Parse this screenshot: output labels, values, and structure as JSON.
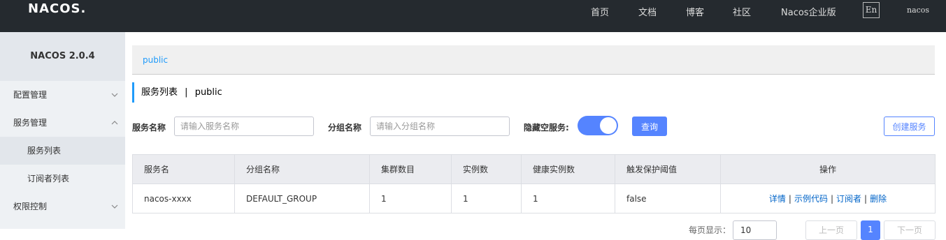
{
  "header": {
    "logo": "NACOS",
    "logo_dot": ".",
    "nav": [
      "首页",
      "文档",
      "博客",
      "社区",
      "Nacos企业版"
    ],
    "lang": "En",
    "user": "nacos"
  },
  "sidebar": {
    "version": "NACOS 2.0.4",
    "items": [
      {
        "label": "配置管理",
        "expanded": false
      },
      {
        "label": "服务管理",
        "expanded": true
      },
      {
        "label": "服务列表",
        "active": true
      },
      {
        "label": "订阅者列表"
      },
      {
        "label": "权限控制",
        "expanded": false
      }
    ]
  },
  "namespace": {
    "current": "public"
  },
  "page": {
    "title": "服务列表",
    "separator": "|",
    "namespace": "public"
  },
  "filters": {
    "service_label": "服务名称",
    "service_placeholder": "请输入服务名称",
    "group_label": "分组名称",
    "group_placeholder": "请输入分组名称",
    "hide_empty_label": "隐藏空服务:",
    "hide_empty_on": true,
    "query_button": "查询",
    "create_button": "创建服务"
  },
  "table": {
    "headers": [
      "服务名",
      "分组名称",
      "集群数目",
      "实例数",
      "健康实例数",
      "触发保护阈值",
      "操作"
    ],
    "rows": [
      {
        "service": "nacos-xxxx",
        "group": "DEFAULT_GROUP",
        "clusters": "1",
        "instances": "1",
        "healthy": "1",
        "threshold": "false",
        "actions": [
          "详情",
          "示例代码",
          "订阅者",
          "删除"
        ]
      }
    ]
  },
  "pagination": {
    "page_size_label": "每页显示：",
    "page_size": "10",
    "prev": "上一页",
    "current": "1",
    "next": "下一页"
  },
  "colors": {
    "accent": "#5584ff",
    "link": "#0064c8",
    "header_bg": "#252a2f",
    "sidebar_bg": "#eef1f4"
  }
}
